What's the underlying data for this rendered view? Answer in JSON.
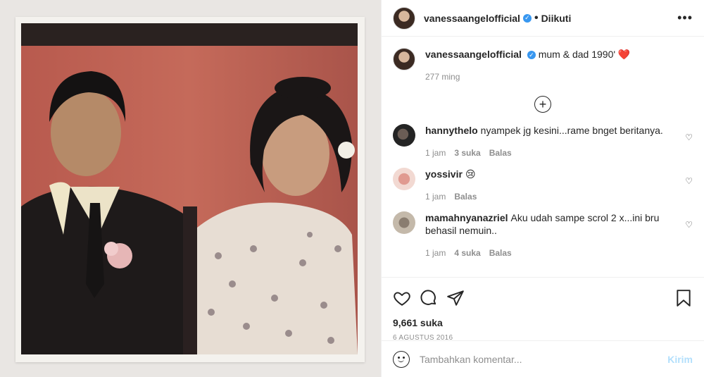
{
  "header": {
    "username": "vanessaangelofficial",
    "separator": "•",
    "follow_label": "Diikuti",
    "more_label": "•••"
  },
  "caption": {
    "username": "vanessaangelofficial",
    "text": "mum & dad 1990' ❤️",
    "time": "277 ming"
  },
  "load_more_label": "+",
  "comments": [
    {
      "username": "hannythelo",
      "text": "nyampek jg kesini...rame bnget beritanya.",
      "time": "1 jam",
      "likes": "3 suka",
      "reply": "Balas"
    },
    {
      "username": "yossivir",
      "text": "😢",
      "time": "1 jam",
      "likes": "",
      "reply": "Balas"
    },
    {
      "username": "mamahnyanazriel",
      "text": "Aku udah sampe scrol 2 x...ini bru behasil nemuin..",
      "time": "1 jam",
      "likes": "4 suka",
      "reply": "Balas"
    }
  ],
  "like_small": "♡",
  "likes_count": "9,661 suka",
  "post_date": "6 AGUSTUS 2016",
  "add_comment": {
    "placeholder": "Tambahkan komentar...",
    "send_label": "Kirim"
  },
  "colors": {
    "accent": "#3897f0",
    "send_disabled": "#b2dffc",
    "muted": "#8e8e8e",
    "heart": "#ed4956"
  },
  "icons": [
    "heart-icon",
    "comment-icon",
    "share-icon",
    "bookmark-icon",
    "emoji-icon",
    "verified-icon",
    "more-icon",
    "add-circle-icon"
  ]
}
